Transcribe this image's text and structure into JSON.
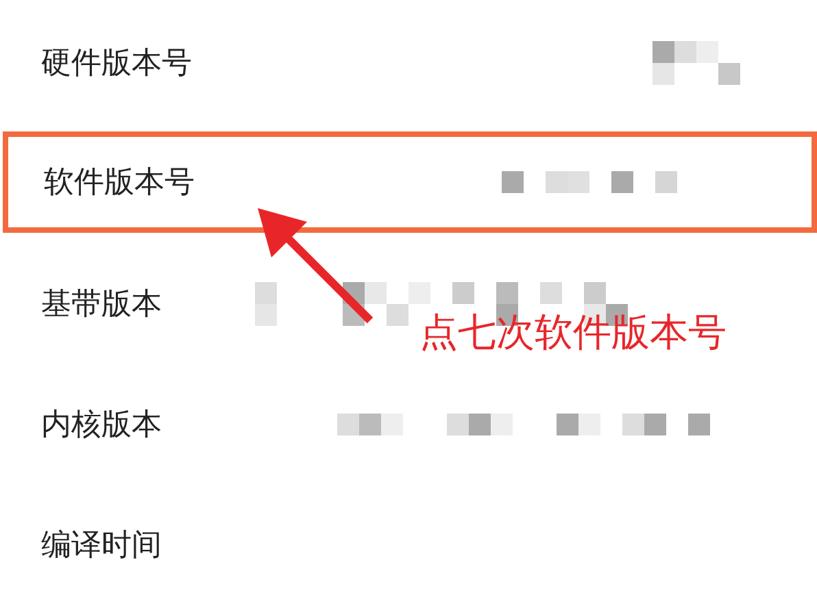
{
  "rows": [
    {
      "label": "硬件版本号",
      "highlighted": false
    },
    {
      "label": "软件版本号",
      "highlighted": true
    },
    {
      "label": "基带版本",
      "highlighted": false
    },
    {
      "label": "内核版本",
      "highlighted": false
    },
    {
      "label": "编译时间",
      "highlighted": false
    }
  ],
  "annotation": {
    "text": "点七次软件版本号"
  }
}
